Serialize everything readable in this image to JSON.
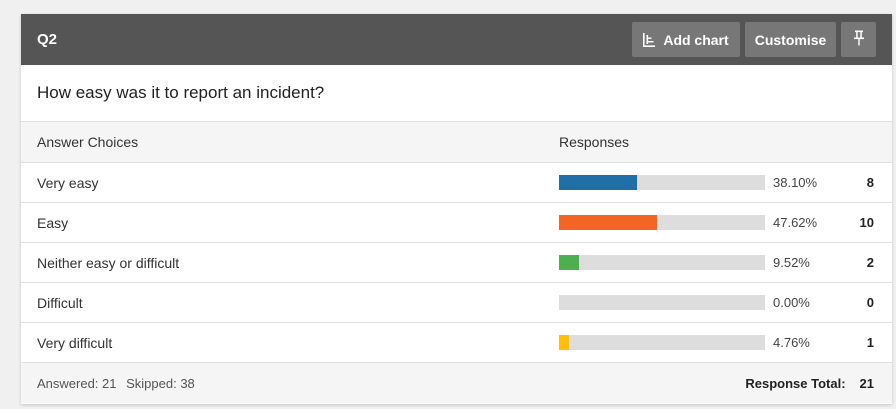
{
  "header": {
    "question_number": "Q2",
    "add_chart_label": "Add chart",
    "customise_label": "Customise",
    "bg_color": "#555555",
    "button_color": "#777777"
  },
  "question": {
    "text": "How easy was it to report an incident?"
  },
  "table": {
    "col_answer": "Answer Choices",
    "col_responses": "Responses",
    "rows": [
      {
        "label": "Very easy",
        "percent": "38.10%",
        "count": "8",
        "fraction": 0.381,
        "color": "#1f6fa8"
      },
      {
        "label": "Easy",
        "percent": "47.62%",
        "count": "10",
        "fraction": 0.4762,
        "color": "#f26522"
      },
      {
        "label": "Neither easy or difficult",
        "percent": "9.52%",
        "count": "2",
        "fraction": 0.0952,
        "color": "#4caf50"
      },
      {
        "label": "Difficult",
        "percent": "0.00%",
        "count": "0",
        "fraction": 0.0,
        "color": "#cccccc"
      },
      {
        "label": "Very difficult",
        "percent": "4.76%",
        "count": "1",
        "fraction": 0.0476,
        "color": "#ffc107"
      }
    ]
  },
  "footer": {
    "answered": "Answered: 21",
    "skipped": "Skipped: 38",
    "total_label": "Response Total:",
    "total_value": "21"
  },
  "icons": {
    "add_chart": "bar-chart-icon",
    "pin": "pin-icon"
  }
}
